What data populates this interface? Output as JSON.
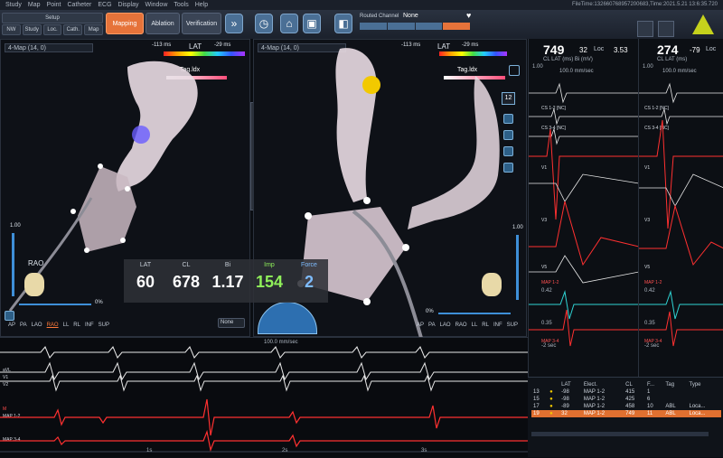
{
  "menu": [
    "Study",
    "Map",
    "Point",
    "Catheter",
    "ECG",
    "Display",
    "Window",
    "Tools",
    "Help"
  ],
  "filetime": "FileTime:132660768957200683,Time:2021.5.21 13:6:35.720",
  "toolbar": {
    "setup_label": "Setup",
    "subtabs": [
      "NW",
      "Study",
      "Loc.",
      "Cath.",
      "Map"
    ],
    "modes": [
      "Mapping",
      "Ablation",
      "Verification"
    ],
    "routed_channel_label": "Routed Channel",
    "routed_channel_value": "None"
  },
  "map1": {
    "title": "4-Map (14, 0)",
    "scale_min": "-113 ms",
    "scale_label": "LAT",
    "scale_max": "-29 ms",
    "tag": "Tag.ldx",
    "view_label": "RAO",
    "slider_value": "1.00",
    "pct": "0%"
  },
  "map2": {
    "title": "4-Map (14, 0)",
    "scale_min": "-113 ms",
    "scale_label": "LAT",
    "scale_max": "-29 ms",
    "tag": "Tag.ldx",
    "slider_value": "1.00",
    "pct": "0%",
    "side_count": "12"
  },
  "views": [
    "AP",
    "PA",
    "LAO",
    "RAO",
    "LL",
    "RL",
    "INF",
    "SUP"
  ],
  "none_select": "None",
  "readout": {
    "lat_label": "LAT",
    "lat": "60",
    "cl_label": "CL",
    "cl": "678",
    "bi_label": "Bi",
    "bi": "1.17",
    "imp_label": "Imp",
    "imp": "154",
    "force_label": "Force",
    "force": "2"
  },
  "mid_tool": {
    "value": "2"
  },
  "ecg_panel": {
    "scale": "100.0 mm/sec",
    "channels": [
      "aVL",
      "V1",
      "V2",
      "M",
      "MAP 1-2",
      "MAP 3-4"
    ],
    "ticks": [
      "1s",
      "2s",
      "3s"
    ]
  },
  "right_a": {
    "cl": "749",
    "loc_val": "32",
    "loc_label": "Loc",
    "v3": "3.53",
    "sub": "CL  LAT (ms)  Bi (mV)",
    "speed": "100.0 mm/sec",
    "scale_top": "1.00",
    "scale1": "0.42",
    "scale2": "0.35",
    "scale3": "-2 sec",
    "labels": [
      "CS 1-2 [NC]",
      "CS 3-4 [NC]",
      "V1",
      "V3",
      "V5",
      "MAP 1-2",
      "MAP 3-4"
    ]
  },
  "right_b": {
    "cl": "274",
    "loc_val": "-79",
    "loc_label": "Loc",
    "sub": "CL  LAT (ms)",
    "speed": "100.0 mm/sec",
    "scale_top": "1.00",
    "scale1": "0.42",
    "scale2": "0.35",
    "scale3": "-2 sec",
    "labels": [
      "CS 1-2 [NC]",
      "CS 3-4 [NC]",
      "V1",
      "V3",
      "V5",
      "MAP 1-2",
      "MAP 3-4"
    ]
  },
  "table": {
    "headers": [
      "",
      "",
      "LAT",
      "Elect.",
      "CL",
      "F...",
      "Tag",
      "Type"
    ],
    "rows": [
      {
        "id": "13",
        "lat": "-98",
        "elec": "MAP 1-2",
        "cl": "415",
        "f": "1",
        "tag": "",
        "type": ""
      },
      {
        "id": "15",
        "lat": "-98",
        "elec": "MAP 1-2",
        "cl": "425",
        "f": "6",
        "tag": "",
        "type": ""
      },
      {
        "id": "17",
        "lat": "-89",
        "elec": "MAP 1-2",
        "cl": "458",
        "f": "10",
        "tag": "ABL",
        "type": "Loca..."
      },
      {
        "id": "19",
        "lat": "32",
        "elec": "MAP 1-2",
        "cl": "749",
        "f": "11",
        "tag": "ABL",
        "type": "Loca..."
      }
    ]
  }
}
